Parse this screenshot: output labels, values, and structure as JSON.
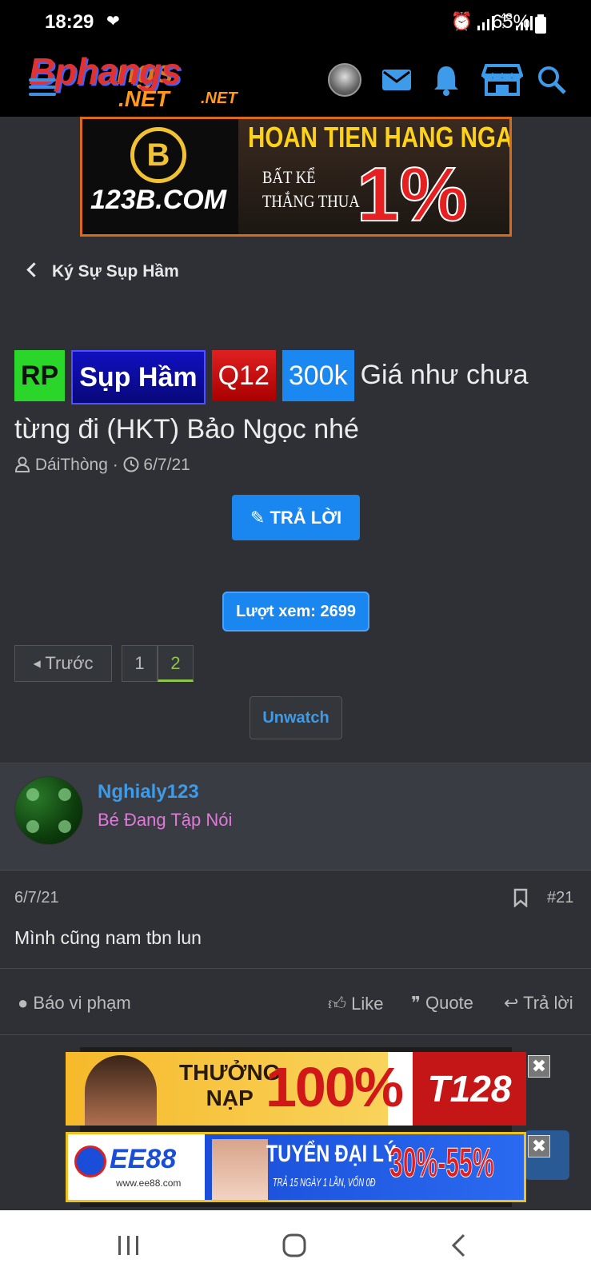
{
  "status": {
    "time": "18:29",
    "battery": "65%"
  },
  "header": {
    "logo_main": "Bphangs",
    "logo_ghost": "ngs",
    "logo_net": ".NET",
    "logo_net2": ".NET"
  },
  "banner_top": {
    "site": "123B.COM",
    "headline": "HOAN TIEN HANG NGAY",
    "sub1": "BẤT KỂ",
    "sub2": "THẮNG THUA",
    "percent": "1%",
    "logo_letter": "B"
  },
  "breadcrumb": {
    "label": "Ký Sự Sụp Hầm"
  },
  "thread": {
    "tags": [
      "RP",
      "Sụp Hầm",
      "Q12",
      "300k"
    ],
    "title": "Giá như chưa từng đi (HKT) Bảo Ngọc nhé",
    "author": "DáiThòng",
    "date": "6/7/21",
    "reply_label": "TRẢ LỜI",
    "views": "Lượt xem: 2699",
    "prev_label": "Trước",
    "pages": [
      "1",
      "2"
    ],
    "unwatch_label": "Unwatch"
  },
  "post": {
    "username": "Nghialy123",
    "user_title": "Bé Đang Tập Nói",
    "date": "6/7/21",
    "number": "#21",
    "content": "Mình cũng nam tbn lun",
    "report_label": "Báo vi phạm",
    "like_label": "Like",
    "quote_label": "Quote",
    "reply_label": "Trả lời"
  },
  "ads": {
    "ad1_text1": "THƯỞNG",
    "ad1_text2": "NẠP",
    "ad1_pct": "100%",
    "ad1_brand": "T128",
    "ad2_brand": "EE88",
    "ad2_site": "www.ee88.com",
    "ad2_text": "TUYỂN ĐẠI LÝ",
    "ad2_sub": "TRẢ 15 NGÀY 1 LẦN, VỐN 0Đ",
    "ad2_pct": "30%-55%",
    "close": "✖"
  },
  "colors": {
    "accent": "#1a86f0",
    "link": "#3d9be9",
    "bg": "#2e3035"
  }
}
